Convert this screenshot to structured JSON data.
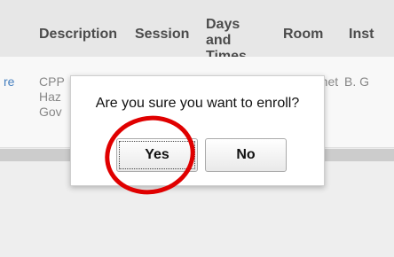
{
  "table": {
    "headers": {
      "description": "Description",
      "session": "Session",
      "days_times": "Days and Times",
      "room": "Room",
      "instructor": "Inst"
    },
    "row": {
      "link_fragment": "re",
      "description": "CPP Haz Gov",
      "room_fragment": "rnet",
      "instructor_fragment": "B. G"
    }
  },
  "dialog": {
    "message": "Are you sure you want to enroll?",
    "yes_label": "Yes",
    "no_label": "No"
  },
  "annotation": {
    "ring_color": "#e00000"
  }
}
